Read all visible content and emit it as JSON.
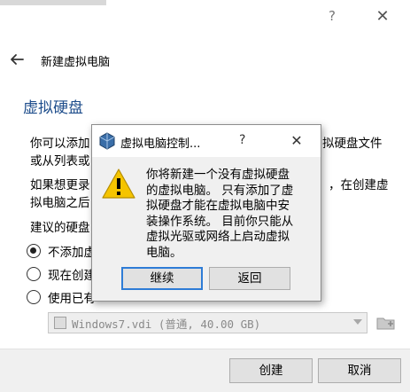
{
  "window": {
    "help_glyph": "?",
    "close_glyph": "✕"
  },
  "wizard": {
    "title": "新建虚拟电脑",
    "section_title": "虚拟硬盘",
    "para1_line1_left": "你可以添加",
    "para1_line1_right": "拟硬盘文件",
    "para1_line2_left": "或从列表或",
    "para2_line1_left": "如果想更录",
    "para2_line1_right": "，在创建虚",
    "para2_line2_left": "拟电脑之后",
    "para2_line2_right": "",
    "suggest_label": "建议的硬盘",
    "options": [
      {
        "label": "不添加虚",
        "checked": true
      },
      {
        "label": "现在创建",
        "checked": false
      },
      {
        "label": "使用已有",
        "checked": false
      }
    ],
    "disk_value": "Windows7.vdi (普通, 40.00 GB)",
    "create_button": "创建",
    "cancel_button": "取消"
  },
  "dialog": {
    "title": "虚拟电脑控制...",
    "help_glyph": "?",
    "close_glyph": "✕",
    "message_lines": [
      "你将新建一个没有虚拟硬盘",
      "的虚拟电脑。 只有添加了虚",
      "拟硬盘才能在虚拟电脑中安",
      "装操作系统。 目前你只能从",
      "虚拟光驱或网络上启动虚拟",
      "电脑。"
    ],
    "continue_button": "继续",
    "back_button": "返回"
  },
  "colors": {
    "section_title": "#1f4e8c",
    "focus_border": "#2e7cd6",
    "warning_yellow": "#f5c400"
  }
}
